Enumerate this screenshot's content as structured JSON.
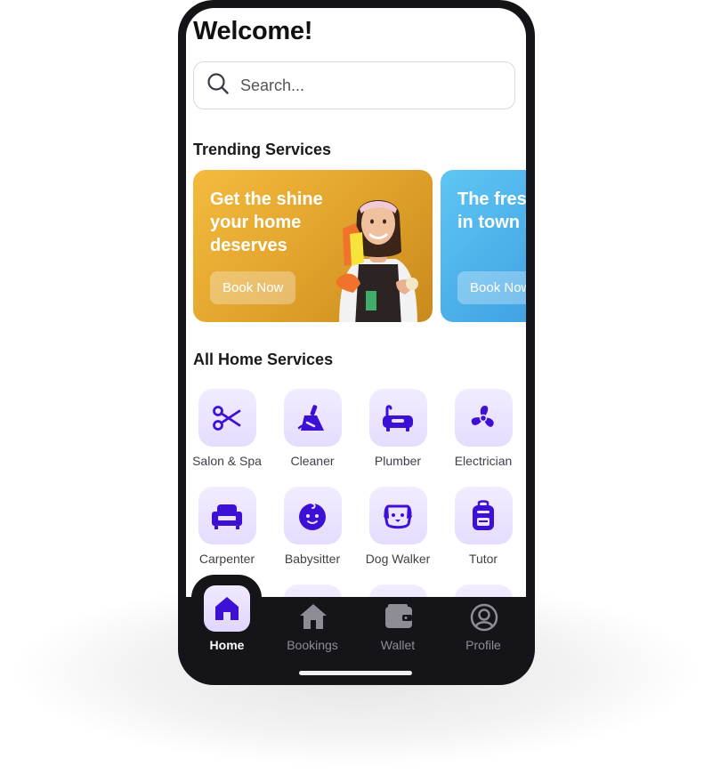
{
  "header": {
    "title": "Welcome!"
  },
  "search": {
    "placeholder": "Search..."
  },
  "trending": {
    "title": "Trending Services",
    "cards": [
      {
        "text": "Get the shine your home deserves",
        "button": "Book Now"
      },
      {
        "text": "The fresh paint in town is back!",
        "button": "Book Now"
      }
    ]
  },
  "services": {
    "title": "All Home Services",
    "items": [
      {
        "label": "Salon & Spa",
        "icon": "scissors-icon"
      },
      {
        "label": "Cleaner",
        "icon": "broom-icon"
      },
      {
        "label": "Plumber",
        "icon": "bathtub-icon"
      },
      {
        "label": "Electrician",
        "icon": "fan-icon"
      },
      {
        "label": "Carpenter",
        "icon": "armchair-icon"
      },
      {
        "label": "Babysitter",
        "icon": "baby-icon"
      },
      {
        "label": "Dog Walker",
        "icon": "dog-icon"
      },
      {
        "label": "Tutor",
        "icon": "backpack-icon"
      }
    ]
  },
  "nav": {
    "items": [
      {
        "label": "Home",
        "icon": "home-icon",
        "active": true
      },
      {
        "label": "Bookings",
        "icon": "house-icon",
        "active": false
      },
      {
        "label": "Wallet",
        "icon": "wallet-icon",
        "active": false
      },
      {
        "label": "Profile",
        "icon": "profile-icon",
        "active": false
      }
    ]
  },
  "colors": {
    "accent": "#3d10d6",
    "tile": "#ebe3ff",
    "nav_bg": "#151418",
    "card1": "#e0a12b",
    "card2": "#3d9ee2"
  }
}
